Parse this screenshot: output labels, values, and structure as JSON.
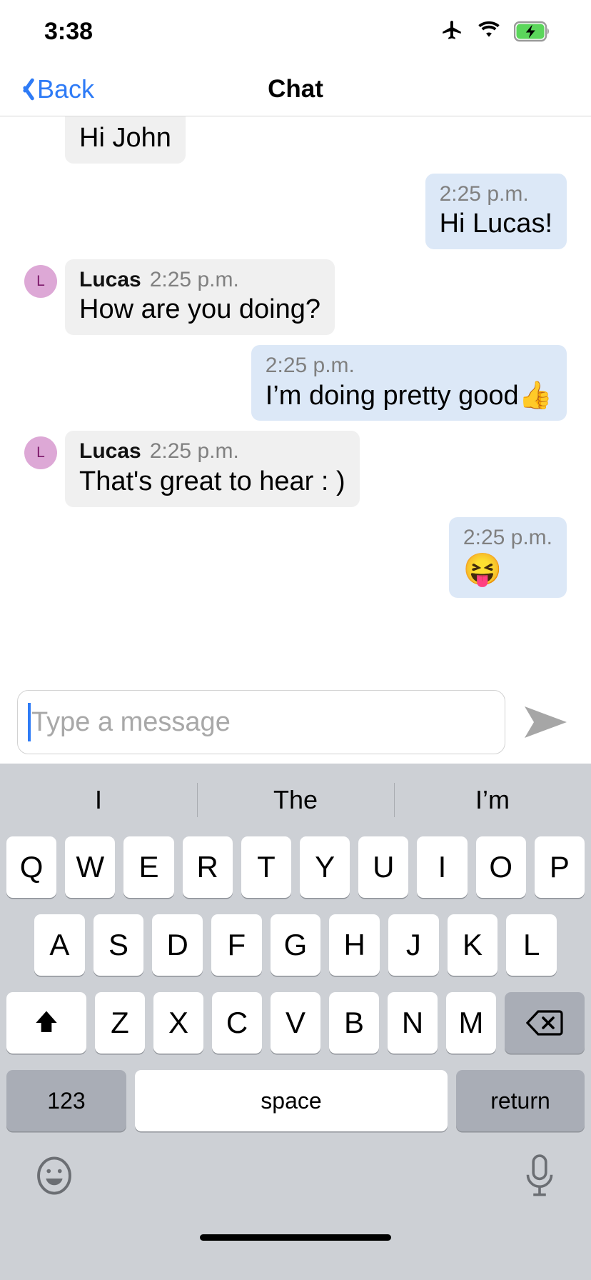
{
  "status_bar": {
    "time": "3:38",
    "icons": [
      "airplane-mode-icon",
      "wifi-icon",
      "battery-charging-icon"
    ],
    "battery_color": "#5bd65b"
  },
  "nav": {
    "back_label": "Back",
    "back_icon": "chevron-left-icon",
    "title": "Chat",
    "accent_color": "#2e7bf6"
  },
  "conversation": {
    "messages": [
      {
        "id": "m1",
        "direction": "incoming",
        "sender": "",
        "time": "",
        "text": "Hi John",
        "clipped": true,
        "show_avatar": false,
        "show_meta": false
      },
      {
        "id": "m2",
        "direction": "outgoing",
        "sender": "",
        "time": "2:25 p.m.",
        "text": "Hi Lucas!",
        "clipped": false,
        "show_avatar": false,
        "show_meta": true
      },
      {
        "id": "m3",
        "direction": "incoming",
        "sender": "Lucas",
        "time": "2:25 p.m.",
        "text": "How are you doing?",
        "avatar_initial": "L",
        "clipped": false,
        "show_avatar": true,
        "show_meta": true
      },
      {
        "id": "m4",
        "direction": "outgoing",
        "sender": "",
        "time": "2:25 p.m.",
        "text": "I’m doing pretty good👍",
        "clipped": false,
        "show_avatar": false,
        "show_meta": true
      },
      {
        "id": "m5",
        "direction": "incoming",
        "sender": "Lucas",
        "time": "2:25 p.m.",
        "text": "That's great to hear : )",
        "avatar_initial": "L",
        "clipped": false,
        "show_avatar": true,
        "show_meta": true
      },
      {
        "id": "m6",
        "direction": "outgoing",
        "sender": "",
        "time": "2:25 p.m.",
        "text": "😝",
        "clipped": false,
        "show_avatar": false,
        "show_meta": true,
        "emoji_only": true
      }
    ],
    "incoming_bubble_color": "#f0f0f0",
    "outgoing_bubble_color": "#dce8f7",
    "avatar_bg_color": "#dda8d6",
    "avatar_text_color": "#7d1a6b",
    "timestamp_color": "#808080"
  },
  "composer": {
    "input_value": "",
    "placeholder": "Type a message",
    "send_icon": "send-arrow-icon",
    "send_icon_color": "#a0a0a0",
    "caret_color": "#2e7bf6"
  },
  "keyboard": {
    "suggestions": [
      "I",
      "The",
      "I’m"
    ],
    "row1": [
      "Q",
      "W",
      "E",
      "R",
      "T",
      "Y",
      "U",
      "I",
      "O",
      "P"
    ],
    "row2": [
      "A",
      "S",
      "D",
      "F",
      "G",
      "H",
      "J",
      "K",
      "L"
    ],
    "row3_letters": [
      "Z",
      "X",
      "C",
      "V",
      "B",
      "N",
      "M"
    ],
    "shift_icon": "shift-up-arrow-icon",
    "backspace_icon": "backspace-delete-icon",
    "numbers_key": "123",
    "space_key": "space",
    "return_key": "return",
    "emoji_icon": "emoji-smiley-icon",
    "mic_icon": "microphone-icon",
    "background_color": "#cdd0d5",
    "key_color": "#ffffff",
    "modifier_key_color": "#a9adb6"
  }
}
